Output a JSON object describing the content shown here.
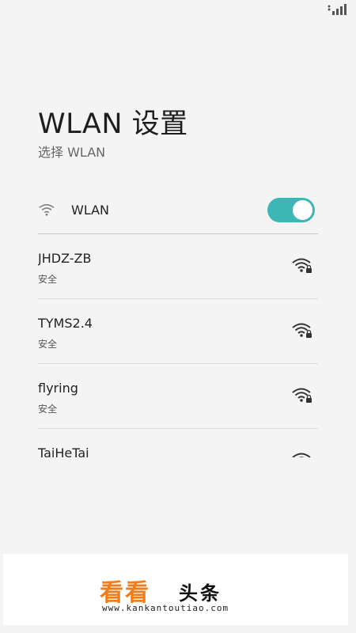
{
  "status_bar": {
    "signal_icon": "cellular-signal-icon"
  },
  "header": {
    "title": "WLAN 设置",
    "subtitle": "选择 WLAN"
  },
  "wlan": {
    "label": "WLAN",
    "icon": "wifi-icon",
    "enabled": true,
    "accent": "#3cb7b6"
  },
  "networks": [
    {
      "name": "JHDZ-ZB",
      "security": "安全",
      "icon": "wifi-lock-icon"
    },
    {
      "name": "TYMS2.4",
      "security": "安全",
      "icon": "wifi-lock-icon"
    },
    {
      "name": "flyring",
      "security": "安全",
      "icon": "wifi-lock-icon"
    },
    {
      "name": "TaiHeTai",
      "security": "",
      "icon": "wifi-lock-icon"
    }
  ],
  "ad": {
    "logo_a": "看看",
    "logo_b": "头条",
    "url": "www.kankantoutiao.com",
    "brand_color": "#f07c1c"
  }
}
